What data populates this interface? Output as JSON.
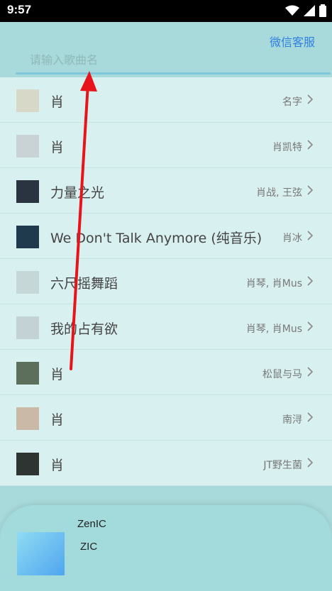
{
  "status": {
    "time": "9:57"
  },
  "header": {
    "service_label": "微信客服",
    "search_placeholder": "请输入歌曲名",
    "search_value": ""
  },
  "songs": [
    {
      "title": "肖",
      "artist": "名字",
      "thumb_color": "#d8d8c8"
    },
    {
      "title": "肖",
      "artist": "肖凯特",
      "thumb_color": "#c9d3d6"
    },
    {
      "title": "力量之光",
      "artist": "肖战, 王弦",
      "thumb_color": "#2a3440"
    },
    {
      "title": "We Don't Talk Anymore (纯音乐)",
      "artist": "肖冰",
      "thumb_color": "#1e3a4c"
    },
    {
      "title": "六尺摇舞蹈",
      "artist": "肖琴, 肖Mus",
      "thumb_color": "#c6d7d8"
    },
    {
      "title": "我的占有欲",
      "artist": "肖琴, 肖Mus",
      "thumb_color": "#c3d2d4"
    },
    {
      "title": "肖",
      "artist": "松鼠与马",
      "thumb_color": "#5c6f5b"
    },
    {
      "title": "肖",
      "artist": "南浔",
      "thumb_color": "#cab9a6"
    },
    {
      "title": "肖",
      "artist": "JT野生菌",
      "thumb_color": "#2d3431"
    }
  ],
  "player": {
    "title": "ZenIC",
    "subtitle": "ZIC"
  },
  "colors": {
    "accent": "#2f7fe0",
    "background": "#a8dadb",
    "list_bg": "#d9f0f0",
    "arrow": "#e8141c"
  }
}
